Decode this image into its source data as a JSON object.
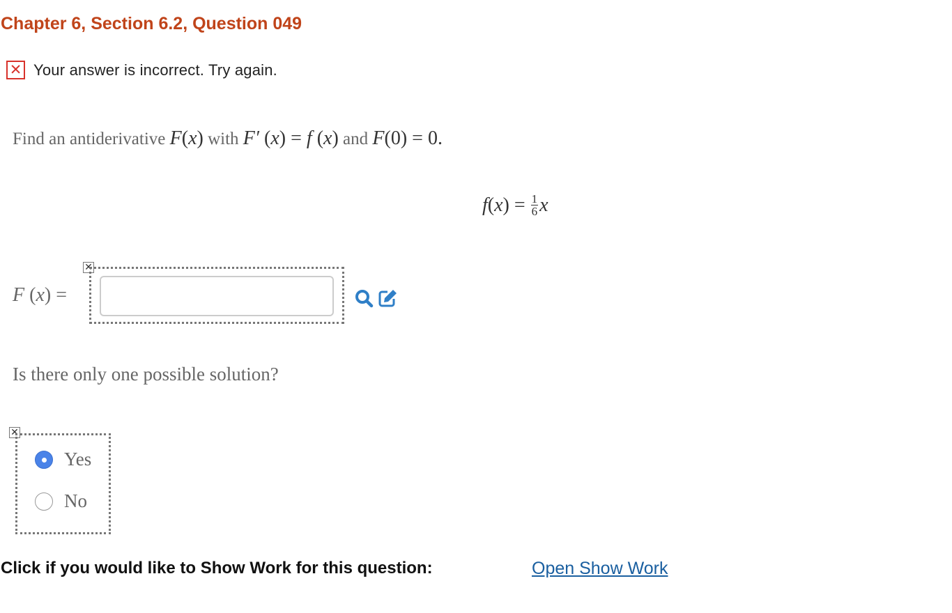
{
  "header": {
    "title": "Chapter 6, Section 6.2, Question 049"
  },
  "feedback": {
    "icon": "x-mark-icon",
    "message": "Your answer is incorrect.  Try again."
  },
  "question": {
    "prompt_text_1": "Find an antiderivative ",
    "prompt_math_1": "F",
    "prompt_math_1b": "(",
    "prompt_math_1c": "x",
    "prompt_math_1d": ")",
    "prompt_text_2": " with ",
    "prompt_math_2": "F′",
    "prompt_math_2b": " (",
    "prompt_math_2c": "x",
    "prompt_math_2d": ") = ",
    "prompt_math_2e": "f",
    "prompt_math_2f": " (",
    "prompt_math_2g": "x",
    "prompt_math_2h": ")",
    "prompt_text_3": " and ",
    "prompt_math_3": "F",
    "prompt_math_3b": "(0) = 0.",
    "given_f": "f",
    "given_paren": " (",
    "given_x": "x",
    "given_eq": ") = ",
    "frac_num": "1",
    "frac_den": "6",
    "given_tail": "x"
  },
  "answer": {
    "label_F": "F",
    "label_paren": " (",
    "label_x": "x",
    "label_eq": ") =",
    "value": "",
    "placeholder": ""
  },
  "question2": {
    "text": "Is there only one possible solution?",
    "options": [
      {
        "label": "Yes",
        "selected": true
      },
      {
        "label": "No",
        "selected": false
      }
    ]
  },
  "show_work": {
    "prompt": "Click if you would like to Show Work for this question:",
    "link": "Open Show Work"
  },
  "colors": {
    "title": "#c0441a",
    "error": "#d8322b",
    "link": "#1a5fa0",
    "radio_selected": "#4a83e8",
    "icon_blue": "#2f7fc7"
  },
  "icons": [
    "x-mark-icon",
    "search-icon",
    "edit-icon",
    "incorrect-marker-icon"
  ]
}
